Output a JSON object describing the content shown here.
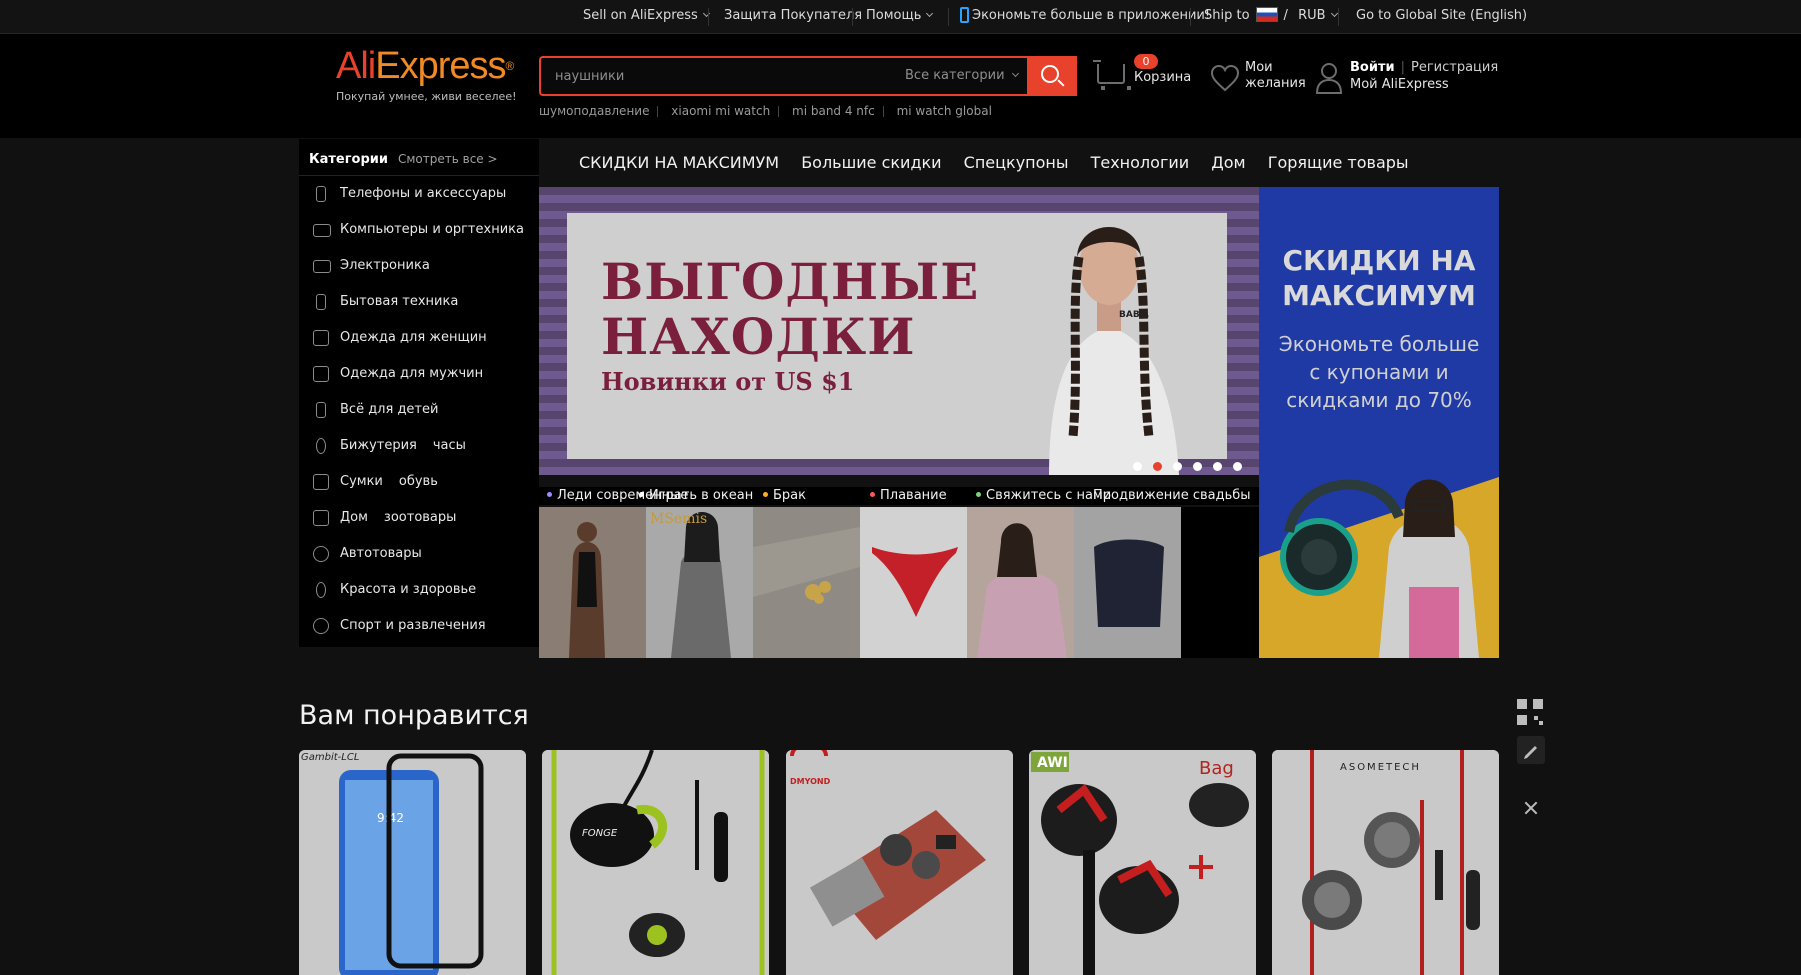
{
  "topbar": {
    "sell": "Sell on AliExpress",
    "protection": "Защита Покупателя",
    "help": "Помощь",
    "app_promo": "Экономьте больше в приложении!",
    "ship_to": "Ship to",
    "slash": "/",
    "currency": "RUB",
    "global_site": "Go to Global Site (English)"
  },
  "header": {
    "logo_part1": "Ali",
    "logo_part2": "Express",
    "logo_mark": "®",
    "tagline": "Покупай умнее, живи веселее!",
    "search_placeholder": "наушники",
    "search_category": "Все категории",
    "hints": [
      "шумоподавление",
      "xiaomi mi watch",
      "mi band 4 nfc",
      "mi watch global"
    ],
    "cart_count": "0",
    "cart_label": "Корзина",
    "wish_line1": "Мои",
    "wish_line2": "желания",
    "login": "Войти",
    "register": "Регистрация",
    "my_ali": "Мой AliExpress",
    "accent_color": "#e8412c"
  },
  "categories": {
    "title": "Категории",
    "see_all": "Смотреть все >",
    "items": [
      {
        "label": "Телефоны и аксессуары",
        "icon": "phone-icon"
      },
      {
        "label": "Компьютеры и оргтехника",
        "icon": "laptop-icon"
      },
      {
        "label": "Электроника",
        "icon": "camera-icon"
      },
      {
        "label": "Бытовая техника",
        "icon": "appliance-icon"
      },
      {
        "label": "Одежда для женщин",
        "icon": "dress-icon"
      },
      {
        "label": "Одежда для мужчин",
        "icon": "shirt-icon"
      },
      {
        "label": "Всё для детей",
        "icon": "bottle-icon"
      },
      {
        "label": "Бижутерия",
        "extra": "часы",
        "icon": "ring-icon"
      },
      {
        "label": "Сумки",
        "extra": "обувь",
        "icon": "bag-icon"
      },
      {
        "label": "Дом",
        "extra": "зоотовары",
        "icon": "home-icon"
      },
      {
        "label": "Автотовары",
        "icon": "wheel-icon"
      },
      {
        "label": "Красота и здоровье",
        "icon": "mirror-icon"
      },
      {
        "label": "Спорт и развлечения",
        "icon": "ball-icon"
      }
    ]
  },
  "nav_tabs": [
    "СКИДКИ НА МАКСИМУМ",
    "Большие скидки",
    "Спецкупоны",
    "Технологии",
    "Дом",
    "Горящие товары"
  ],
  "hero": {
    "title_line1": "ВЫГОДНЫЕ",
    "title_line2": "НАХОДКИ",
    "subtitle": "Новинки от US $1",
    "shirt_text": "BABE.",
    "slides": 6,
    "active_slide": 2
  },
  "promo": {
    "title_line1": "СКИДКИ НА",
    "title_line2": "МАКСИМУМ",
    "sub_line1": "Экономьте больше",
    "sub_line2": "с купонами и",
    "sub_line3": "скидками до 70%"
  },
  "tiles": {
    "labels": [
      {
        "text": "Леди современные",
        "color": "#9b8cff"
      },
      {
        "text": "Играть в океан",
        "color": "#ffffff"
      },
      {
        "text": "Брак",
        "color": "#ffb020"
      },
      {
        "text": "Плавание",
        "color": "#ff5a5a"
      },
      {
        "text": "Свяжитесь с нами",
        "color": "#7cd37c"
      },
      {
        "text": "Продвижение свадьбы",
        "color": "#ffffff"
      }
    ],
    "brand_mark": "MSemis"
  },
  "recommend": {
    "title": "Вам понравится",
    "products": [
      {
        "mark": "Gambit-LCL",
        "screen_time": "9:42"
      },
      {
        "mark": "FONGE"
      },
      {
        "mark": "DMYOND"
      },
      {
        "mark": "AWI",
        "mark2": "Bag"
      },
      {
        "mark": "ASOMETECH"
      }
    ]
  }
}
